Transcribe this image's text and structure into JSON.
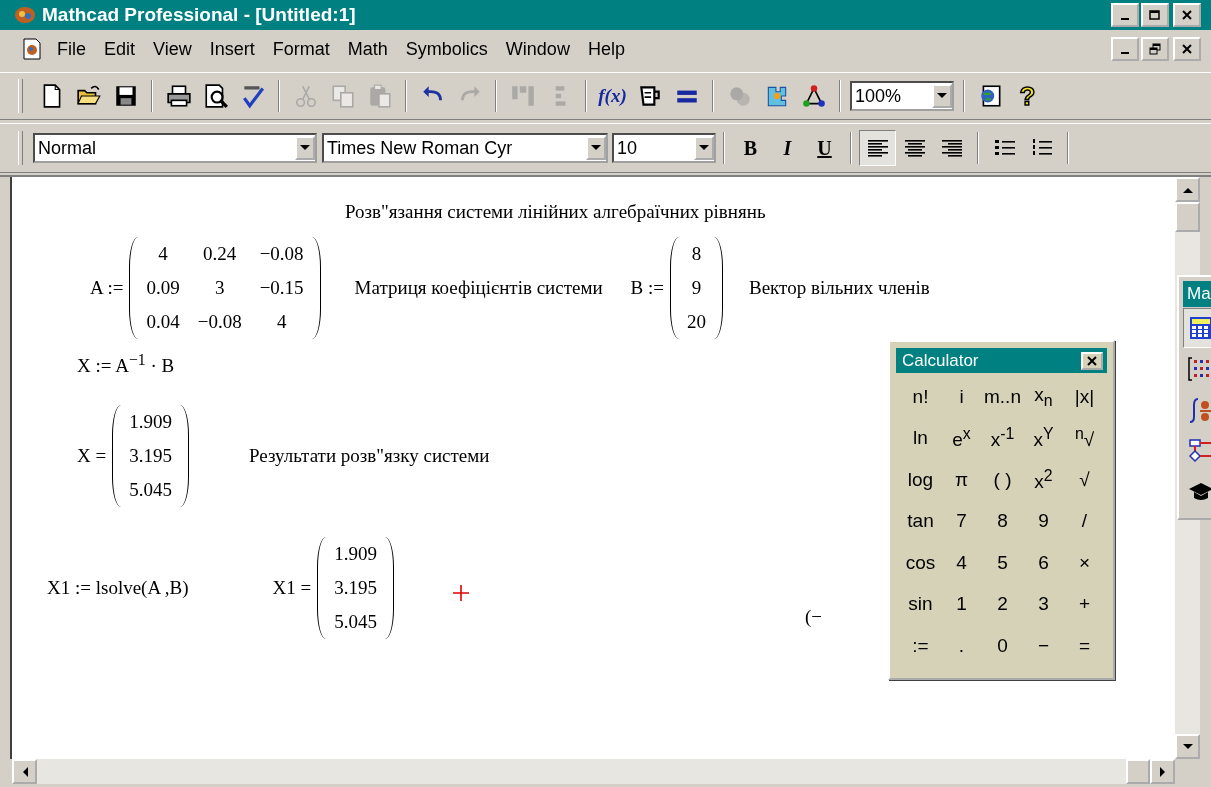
{
  "window": {
    "title": "Mathcad Professional - [Untitled:1]"
  },
  "menu": [
    "File",
    "Edit",
    "View",
    "Insert",
    "Format",
    "Math",
    "Symbolics",
    "Window",
    "Help"
  ],
  "toolbar": [
    {
      "kind": "new",
      "disabled": false
    },
    {
      "kind": "open",
      "disabled": false
    },
    {
      "kind": "save",
      "disabled": false
    },
    {
      "kind": "separator"
    },
    {
      "kind": "print",
      "disabled": false
    },
    {
      "kind": "preview",
      "disabled": false
    },
    {
      "kind": "spell",
      "disabled": false
    },
    {
      "kind": "separator"
    },
    {
      "kind": "cut",
      "disabled": true
    },
    {
      "kind": "copy",
      "disabled": true
    },
    {
      "kind": "paste",
      "disabled": true
    },
    {
      "kind": "separator"
    },
    {
      "kind": "undo",
      "disabled": false
    },
    {
      "kind": "redo",
      "disabled": true
    },
    {
      "kind": "separator"
    },
    {
      "kind": "align-across",
      "disabled": true
    },
    {
      "kind": "align-down",
      "disabled": true
    },
    {
      "kind": "separator"
    },
    {
      "kind": "function",
      "label": "f(x)",
      "disabled": false
    },
    {
      "kind": "unit",
      "disabled": false
    },
    {
      "kind": "calculate",
      "disabled": false
    },
    {
      "kind": "separator"
    },
    {
      "kind": "component",
      "disabled": true
    },
    {
      "kind": "wizard",
      "disabled": false
    },
    {
      "kind": "diagram",
      "disabled": false
    },
    {
      "kind": "separator"
    },
    {
      "kind": "zoom",
      "value": "100%"
    },
    {
      "kind": "separator"
    },
    {
      "kind": "resource",
      "disabled": false
    },
    {
      "kind": "help",
      "label": "?",
      "disabled": false
    }
  ],
  "format_bar": {
    "style": "Normal",
    "font": "Times New Roman Cyr",
    "size": "10",
    "text_styles": [
      {
        "kind": "bold",
        "label": "B"
      },
      {
        "kind": "italic",
        "label": "I"
      },
      {
        "kind": "underline",
        "label": "U"
      }
    ],
    "alignment": [
      {
        "kind": "left",
        "selected": true
      },
      {
        "kind": "center",
        "selected": false
      },
      {
        "kind": "right",
        "selected": false
      }
    ],
    "lists": [
      {
        "kind": "bullets"
      },
      {
        "kind": "numbered"
      }
    ]
  },
  "worksheet": {
    "heading": "Розв\"язання системи лінійних алгебраїчних рівнянь",
    "rows": [
      [
        {
          "kind": "matrix",
          "label": "A :=",
          "rows": [
            [
              "4",
              "0.24",
              "−0.08"
            ],
            [
              "0.09",
              "3",
              "−0.15"
            ],
            [
              "0.04",
              "−0.08",
              "4"
            ]
          ]
        },
        {
          "kind": "text",
          "text": "Матриця коефіцієнтів системи"
        },
        {
          "kind": "matrix",
          "label": "B :=",
          "rows": [
            [
              "8"
            ],
            [
              "9"
            ],
            [
              "20"
            ]
          ]
        },
        {
          "kind": "text",
          "text": "Вектор вільних членів"
        }
      ],
      [
        {
          "kind": "expression",
          "text": "X := A$^{−1}$ · B"
        }
      ],
      [
        {
          "kind": "matrix",
          "label": "X =",
          "rows": [
            [
              "1.909"
            ],
            [
              "3.195"
            ],
            [
              "5.045"
            ]
          ]
        },
        {
          "kind": "text",
          "text": "Результати розв\"язку системи"
        }
      ],
      [
        {
          "kind": "expression",
          "text": "X1 := lsolve(A ,B)"
        },
        {
          "kind": "matrix",
          "label": "X1 =",
          "rows": [
            [
              "1.909"
            ],
            [
              "3.195"
            ],
            [
              "5.045"
            ]
          ]
        },
        {
          "kind": "cursor"
        },
        {
          "kind": "expression",
          "text": "(−"
        }
      ]
    ]
  },
  "calculator": {
    "title": "Calculator",
    "keys": [
      "n!",
      "i",
      "m..n",
      "x$_{n}$",
      "|x|",
      "ln",
      "e$^{x}$",
      "x$^{-1}$",
      "x$^{Y}$",
      "$^{n}$√",
      "log",
      "π",
      "( )",
      "x$^{2}$",
      "√",
      "tan",
      "7",
      "8",
      "9",
      "/",
      "cos",
      "4",
      "5",
      "6",
      "×",
      "sin",
      "1",
      "2",
      "3",
      "+",
      ":=",
      ".",
      "0",
      "−",
      "="
    ]
  },
  "math_palette": {
    "title": "Ma",
    "tools": [
      {
        "kind": "calculator",
        "selected": true
      },
      {
        "kind": "matrix",
        "selected": false
      },
      {
        "kind": "calculus",
        "selected": false
      },
      {
        "kind": "programming",
        "selected": false
      },
      {
        "kind": "symbolic",
        "selected": false
      }
    ]
  }
}
